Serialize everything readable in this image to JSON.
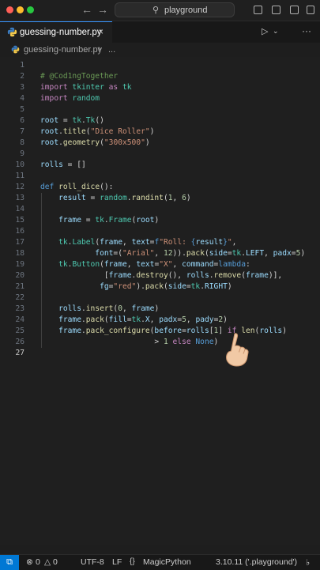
{
  "titlebar": {
    "search_text": "playground"
  },
  "tab": {
    "filename": "guessing-number.py",
    "close": "×"
  },
  "breadcrumb": {
    "file": "guessing-number.py",
    "separator": "›",
    "more": "..."
  },
  "editor": {
    "current_line": 27,
    "lines": [
      {
        "n": "1",
        "tokens": []
      },
      {
        "n": "2",
        "tokens": [
          {
            "t": "# @Cod1ngTogether",
            "c": "com"
          }
        ]
      },
      {
        "n": "3",
        "tokens": [
          {
            "t": "import",
            "c": "kw"
          },
          {
            "t": " tkinter ",
            "c": "mod"
          },
          {
            "t": "as",
            "c": "kw"
          },
          {
            "t": " tk",
            "c": "mod"
          }
        ]
      },
      {
        "n": "4",
        "tokens": [
          {
            "t": "import",
            "c": "kw"
          },
          {
            "t": " random",
            "c": "mod"
          }
        ]
      },
      {
        "n": "5",
        "tokens": []
      },
      {
        "n": "6",
        "tokens": [
          {
            "t": "root",
            "c": "var"
          },
          {
            "t": " = ",
            "c": "op"
          },
          {
            "t": "tk",
            "c": "mod"
          },
          {
            "t": ".",
            "c": "op"
          },
          {
            "t": "Tk",
            "c": "mod"
          },
          {
            "t": "()",
            "c": "op"
          }
        ]
      },
      {
        "n": "7",
        "tokens": [
          {
            "t": "root",
            "c": "var"
          },
          {
            "t": ".",
            "c": "op"
          },
          {
            "t": "title",
            "c": "fn"
          },
          {
            "t": "(",
            "c": "op"
          },
          {
            "t": "\"Dice Roller\"",
            "c": "str"
          },
          {
            "t": ")",
            "c": "op"
          }
        ]
      },
      {
        "n": "8",
        "tokens": [
          {
            "t": "root",
            "c": "var"
          },
          {
            "t": ".",
            "c": "op"
          },
          {
            "t": "geometry",
            "c": "fn"
          },
          {
            "t": "(",
            "c": "op"
          },
          {
            "t": "\"300x500\"",
            "c": "str"
          },
          {
            "t": ")",
            "c": "op"
          }
        ]
      },
      {
        "n": "9",
        "tokens": []
      },
      {
        "n": "10",
        "tokens": [
          {
            "t": "rolls",
            "c": "var"
          },
          {
            "t": " = []",
            "c": "op"
          }
        ]
      },
      {
        "n": "11",
        "tokens": []
      },
      {
        "n": "12",
        "tokens": [
          {
            "t": "def",
            "c": "def"
          },
          {
            "t": " ",
            "c": "op"
          },
          {
            "t": "roll_dice",
            "c": "fn"
          },
          {
            "t": "():",
            "c": "op"
          }
        ]
      },
      {
        "n": "13",
        "indent": 1,
        "tokens": [
          {
            "t": "    result",
            "c": "var"
          },
          {
            "t": " = ",
            "c": "op"
          },
          {
            "t": "random",
            "c": "mod"
          },
          {
            "t": ".",
            "c": "op"
          },
          {
            "t": "randint",
            "c": "fn"
          },
          {
            "t": "(",
            "c": "op"
          },
          {
            "t": "1",
            "c": "num"
          },
          {
            "t": ", ",
            "c": "op"
          },
          {
            "t": "6",
            "c": "num"
          },
          {
            "t": ")",
            "c": "op"
          }
        ]
      },
      {
        "n": "14",
        "indent": 1,
        "tokens": []
      },
      {
        "n": "15",
        "indent": 1,
        "tokens": [
          {
            "t": "    frame",
            "c": "var"
          },
          {
            "t": " = ",
            "c": "op"
          },
          {
            "t": "tk",
            "c": "mod"
          },
          {
            "t": ".",
            "c": "op"
          },
          {
            "t": "Frame",
            "c": "mod"
          },
          {
            "t": "(",
            "c": "op"
          },
          {
            "t": "root",
            "c": "var"
          },
          {
            "t": ")",
            "c": "op"
          }
        ]
      },
      {
        "n": "16",
        "indent": 1,
        "tokens": []
      },
      {
        "n": "17",
        "indent": 1,
        "tokens": [
          {
            "t": "    tk",
            "c": "mod"
          },
          {
            "t": ".",
            "c": "op"
          },
          {
            "t": "Label",
            "c": "mod"
          },
          {
            "t": "(",
            "c": "op"
          },
          {
            "t": "frame",
            "c": "var"
          },
          {
            "t": ", ",
            "c": "op"
          },
          {
            "t": "text",
            "c": "var"
          },
          {
            "t": "=",
            "c": "op"
          },
          {
            "t": "f",
            "c": "def"
          },
          {
            "t": "\"Roll: ",
            "c": "str"
          },
          {
            "t": "{",
            "c": "def"
          },
          {
            "t": "result",
            "c": "var"
          },
          {
            "t": "}",
            "c": "def"
          },
          {
            "t": "\"",
            "c": "str"
          },
          {
            "t": ",",
            "c": "op"
          }
        ]
      },
      {
        "n": "18",
        "indent": 3,
        "tokens": [
          {
            "t": "            font",
            "c": "var"
          },
          {
            "t": "=(",
            "c": "op"
          },
          {
            "t": "\"Arial\"",
            "c": "str"
          },
          {
            "t": ", ",
            "c": "op"
          },
          {
            "t": "12",
            "c": "num"
          },
          {
            "t": ")).",
            "c": "op"
          },
          {
            "t": "pack",
            "c": "fn"
          },
          {
            "t": "(",
            "c": "op"
          },
          {
            "t": "side",
            "c": "var"
          },
          {
            "t": "=",
            "c": "op"
          },
          {
            "t": "tk",
            "c": "mod"
          },
          {
            "t": ".",
            "c": "op"
          },
          {
            "t": "LEFT",
            "c": "var"
          },
          {
            "t": ", ",
            "c": "op"
          },
          {
            "t": "padx",
            "c": "var"
          },
          {
            "t": "=",
            "c": "op"
          },
          {
            "t": "5",
            "c": "num"
          },
          {
            "t": ")",
            "c": "op"
          }
        ]
      },
      {
        "n": "19",
        "indent": 1,
        "tokens": [
          {
            "t": "    tk",
            "c": "mod"
          },
          {
            "t": ".",
            "c": "op"
          },
          {
            "t": "Button",
            "c": "mod"
          },
          {
            "t": "(",
            "c": "op"
          },
          {
            "t": "frame",
            "c": "var"
          },
          {
            "t": ", ",
            "c": "op"
          },
          {
            "t": "text",
            "c": "var"
          },
          {
            "t": "=",
            "c": "op"
          },
          {
            "t": "\"X\"",
            "c": "str"
          },
          {
            "t": ", ",
            "c": "op"
          },
          {
            "t": "command",
            "c": "var"
          },
          {
            "t": "=",
            "c": "op"
          },
          {
            "t": "lambda",
            "c": "def"
          },
          {
            "t": ":",
            "c": "op"
          }
        ]
      },
      {
        "n": "20",
        "indent": 3,
        "tokens": [
          {
            "t": "              [",
            "c": "op"
          },
          {
            "t": "frame",
            "c": "var"
          },
          {
            "t": ".",
            "c": "op"
          },
          {
            "t": "destroy",
            "c": "fn"
          },
          {
            "t": "(), ",
            "c": "op"
          },
          {
            "t": "rolls",
            "c": "var"
          },
          {
            "t": ".",
            "c": "op"
          },
          {
            "t": "remove",
            "c": "fn"
          },
          {
            "t": "(",
            "c": "op"
          },
          {
            "t": "frame",
            "c": "var"
          },
          {
            "t": ")],",
            "c": "op"
          }
        ]
      },
      {
        "n": "21",
        "indent": 3,
        "tokens": [
          {
            "t": "             fg",
            "c": "var"
          },
          {
            "t": "=",
            "c": "op"
          },
          {
            "t": "\"red\"",
            "c": "str"
          },
          {
            "t": ").",
            "c": "op"
          },
          {
            "t": "pack",
            "c": "fn"
          },
          {
            "t": "(",
            "c": "op"
          },
          {
            "t": "side",
            "c": "var"
          },
          {
            "t": "=",
            "c": "op"
          },
          {
            "t": "tk",
            "c": "mod"
          },
          {
            "t": ".",
            "c": "op"
          },
          {
            "t": "RIGHT",
            "c": "var"
          },
          {
            "t": ")",
            "c": "op"
          }
        ]
      },
      {
        "n": "22",
        "indent": 1,
        "tokens": []
      },
      {
        "n": "23",
        "indent": 1,
        "tokens": [
          {
            "t": "    rolls",
            "c": "var"
          },
          {
            "t": ".",
            "c": "op"
          },
          {
            "t": "insert",
            "c": "fn"
          },
          {
            "t": "(",
            "c": "op"
          },
          {
            "t": "0",
            "c": "num"
          },
          {
            "t": ", ",
            "c": "op"
          },
          {
            "t": "frame",
            "c": "var"
          },
          {
            "t": ")",
            "c": "op"
          }
        ]
      },
      {
        "n": "24",
        "indent": 1,
        "tokens": [
          {
            "t": "    frame",
            "c": "var"
          },
          {
            "t": ".",
            "c": "op"
          },
          {
            "t": "pack",
            "c": "fn"
          },
          {
            "t": "(",
            "c": "op"
          },
          {
            "t": "fill",
            "c": "var"
          },
          {
            "t": "=",
            "c": "op"
          },
          {
            "t": "tk",
            "c": "mod"
          },
          {
            "t": ".",
            "c": "op"
          },
          {
            "t": "X",
            "c": "var"
          },
          {
            "t": ", ",
            "c": "op"
          },
          {
            "t": "padx",
            "c": "var"
          },
          {
            "t": "=",
            "c": "op"
          },
          {
            "t": "5",
            "c": "num"
          },
          {
            "t": ", ",
            "c": "op"
          },
          {
            "t": "pady",
            "c": "var"
          },
          {
            "t": "=",
            "c": "op"
          },
          {
            "t": "2",
            "c": "num"
          },
          {
            "t": ")",
            "c": "op"
          }
        ]
      },
      {
        "n": "25",
        "indent": 1,
        "tokens": [
          {
            "t": "    frame",
            "c": "var"
          },
          {
            "t": ".",
            "c": "op"
          },
          {
            "t": "pack_configure",
            "c": "fn"
          },
          {
            "t": "(",
            "c": "op"
          },
          {
            "t": "before",
            "c": "var"
          },
          {
            "t": "=",
            "c": "op"
          },
          {
            "t": "rolls",
            "c": "var"
          },
          {
            "t": "[",
            "c": "op"
          },
          {
            "t": "1",
            "c": "num"
          },
          {
            "t": "] ",
            "c": "op"
          },
          {
            "t": "if",
            "c": "kw"
          },
          {
            "t": " ",
            "c": "op"
          },
          {
            "t": "len",
            "c": "fn"
          },
          {
            "t": "(",
            "c": "op"
          },
          {
            "t": "rolls",
            "c": "var"
          },
          {
            "t": ")",
            "c": "op"
          }
        ]
      },
      {
        "n": "26",
        "indent": 6,
        "tokens": [
          {
            "t": "                         > ",
            "c": "op"
          },
          {
            "t": "1",
            "c": "num"
          },
          {
            "t": " ",
            "c": "op"
          },
          {
            "t": "else",
            "c": "kw"
          },
          {
            "t": " ",
            "c": "op"
          },
          {
            "t": "None",
            "c": "def"
          },
          {
            "t": ")",
            "c": "op"
          }
        ]
      },
      {
        "n": "27",
        "tokens": []
      }
    ]
  },
  "statusbar": {
    "errors": "0",
    "warnings": "0",
    "encoding": "UTF-8",
    "eol": "LF",
    "language": "MagicPython",
    "interpreter": "3.10.11 ('.playground')"
  },
  "colors": {
    "accent": "#3794ff",
    "remote": "#0078d4",
    "background": "#1f1f1f"
  }
}
